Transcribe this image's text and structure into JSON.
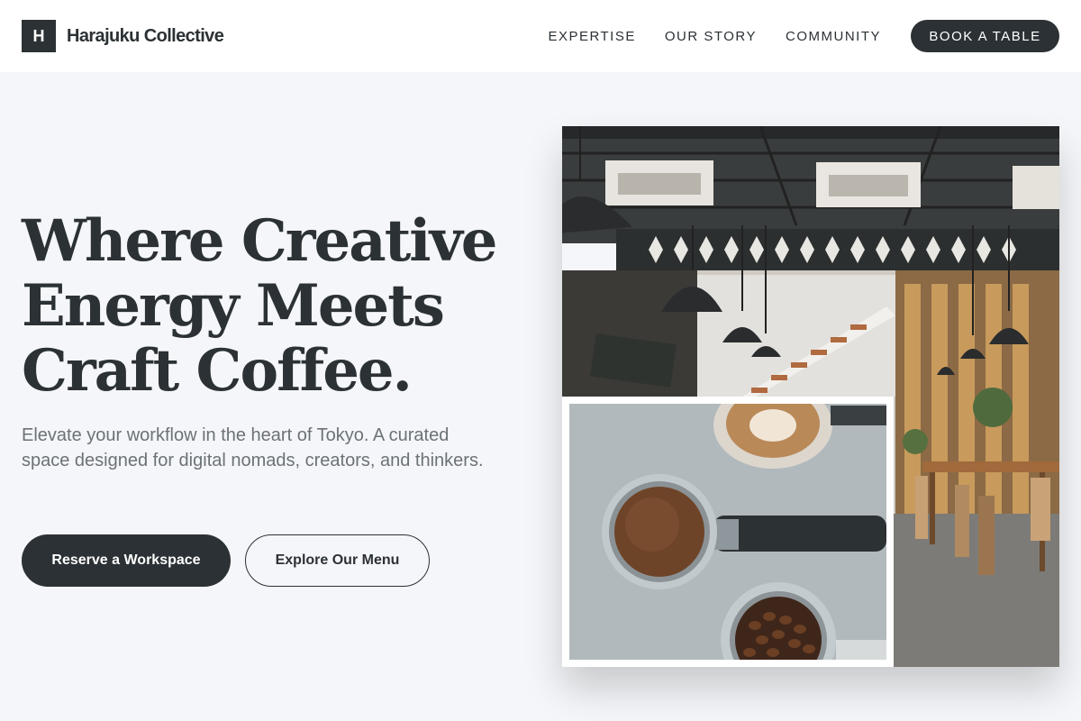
{
  "header": {
    "logo_letter": "H",
    "brand_name": "Harajuku Collective",
    "nav": [
      "EXPERTISE",
      "OUR STORY",
      "COMMUNITY"
    ],
    "cta": "BOOK A TABLE"
  },
  "hero": {
    "title_lines": [
      "Where Creative",
      "Energy Meets",
      "Craft Coffee."
    ],
    "subtitle": "Elevate your workflow in the heart of Tokyo. A curated space designed for digital nomads, creators, and thinkers.",
    "primary_button": "Reserve a Workspace",
    "secondary_button": "Explore Our Menu"
  },
  "colors": {
    "ink": "#2b3134",
    "page_bg": "#f5f6f9",
    "header_bg": "#ffffff",
    "muted_text": "#6b7276"
  },
  "images": {
    "cafe_interior": "industrial-cafe-interior-photo",
    "coffee": "espresso-portafilters-latte-beans-photo"
  }
}
